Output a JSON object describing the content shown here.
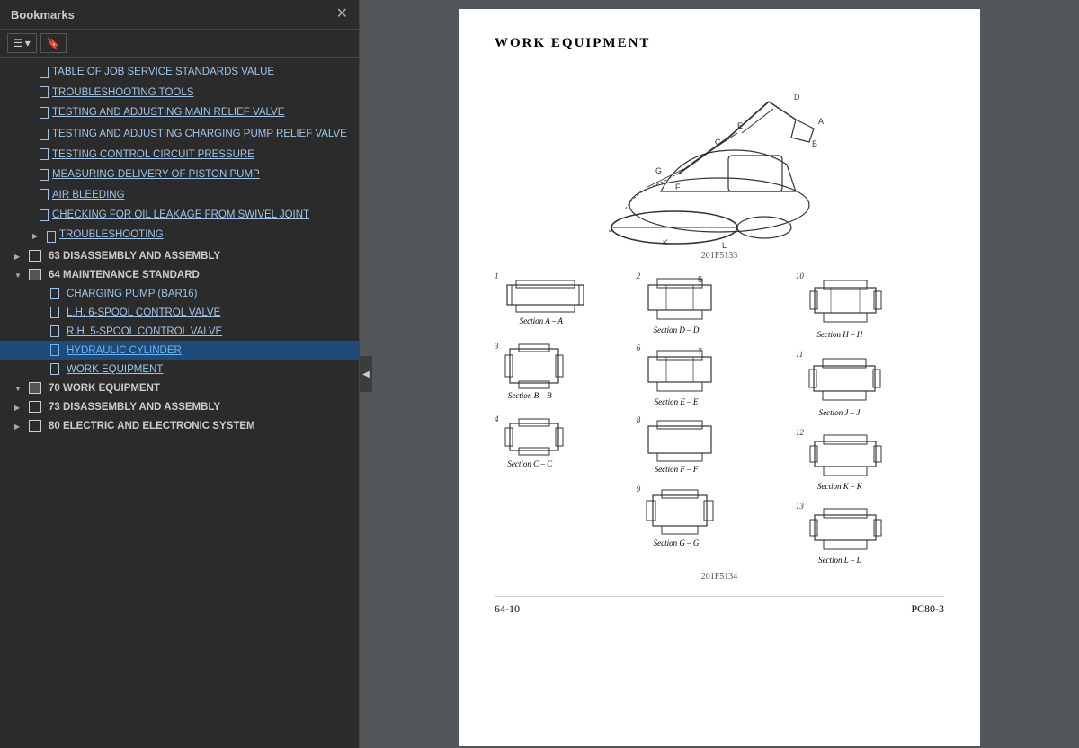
{
  "bookmarks": {
    "title": "Bookmarks",
    "toolbar": {
      "btn1": "☰▾",
      "btn2": "🔖"
    },
    "items": [
      {
        "id": "table-service",
        "label": "TABLE OF JOB SERVICE STANDARDS VALUE",
        "level": 1,
        "indent": "l2",
        "type": "link",
        "expanded": false,
        "active": false
      },
      {
        "id": "troubleshooting-tools",
        "label": "TROUBLESHOOTING TOOLS",
        "level": 1,
        "indent": "l2",
        "type": "link",
        "active": false
      },
      {
        "id": "testing-main-relief",
        "label": "TESTING AND ADJUSTING MAIN RELIEF VALVE",
        "level": 1,
        "indent": "l2",
        "type": "link",
        "active": false
      },
      {
        "id": "testing-charging",
        "label": "TESTING AND ADJUSTING CHARGING PUMP RELIEF VALVE",
        "level": 1,
        "indent": "l2",
        "type": "link",
        "active": false
      },
      {
        "id": "testing-control",
        "label": "TESTING CONTROL CIRCUIT PRESSURE",
        "level": 1,
        "indent": "l2",
        "type": "link",
        "active": false
      },
      {
        "id": "measuring-delivery",
        "label": "MEASURING DELIVERY OF PISTON PUMP",
        "level": 1,
        "indent": "l2",
        "type": "link",
        "active": false
      },
      {
        "id": "air-bleeding",
        "label": "AIR BLEEDING",
        "level": 1,
        "indent": "l2",
        "type": "link",
        "active": false
      },
      {
        "id": "checking-oil",
        "label": "CHECKING FOR OIL LEAKAGE FROM SWIVEL JOINT",
        "level": 1,
        "indent": "l2",
        "type": "link",
        "active": false
      },
      {
        "id": "troubleshooting",
        "label": "TROUBLESHOOTING",
        "level": 1,
        "indent": "l2",
        "type": "link",
        "toggle": "right",
        "active": false
      },
      {
        "id": "disassembly-63",
        "label": "63 DISASSEMBLY AND ASSEMBLY",
        "level": 0,
        "indent": "l1",
        "type": "section",
        "toggle": "right",
        "active": false
      },
      {
        "id": "maintenance-64",
        "label": "64 MAINTENANCE STANDARD",
        "level": 0,
        "indent": "l1",
        "type": "section",
        "toggle": "down",
        "active": false
      },
      {
        "id": "charging-pump",
        "label": "CHARGING PUMP (BAR16)",
        "level": 2,
        "indent": "l3",
        "type": "link",
        "active": false
      },
      {
        "id": "lh-control",
        "label": "L.H. 6-SPOOL CONTROL VALVE",
        "level": 2,
        "indent": "l3",
        "type": "link",
        "active": false
      },
      {
        "id": "rh-control",
        "label": "R.H. 5-SPOOL CONTROL VALVE",
        "level": 2,
        "indent": "l3",
        "type": "link",
        "active": false
      },
      {
        "id": "hydraulic-cylinder",
        "label": "HYDRAULIC CYLINDER",
        "level": 2,
        "indent": "l3",
        "type": "link",
        "active": true
      },
      {
        "id": "work-equipment-bm",
        "label": "WORK EQUIPMENT",
        "level": 2,
        "indent": "l3",
        "type": "link",
        "active": false
      },
      {
        "id": "work-equipment-70",
        "label": "70 WORK EQUIPMENT",
        "level": 0,
        "indent": "l1",
        "type": "section",
        "toggle": "down",
        "active": false
      },
      {
        "id": "disassembly-73",
        "label": "73 DISASSEMBLY AND ASSEMBLY",
        "level": 0,
        "indent": "l1",
        "type": "section",
        "toggle": "right",
        "active": false
      },
      {
        "id": "electric-80",
        "label": "80 ELECTRIC AND ELECTRONIC SYSTEM",
        "level": 0,
        "indent": "l1",
        "type": "section",
        "toggle": "right",
        "active": false
      }
    ]
  },
  "page": {
    "title": "WORK  EQUIPMENT",
    "fig1_number": "201F5133",
    "fig2_number": "201F5134",
    "page_number": "64-10",
    "model": "PC80-3",
    "sections": [
      {
        "id": "A-A",
        "label": "Section A – A",
        "pos": "left-1"
      },
      {
        "id": "D-D",
        "label": "Section D – D",
        "pos": "mid-1"
      },
      {
        "id": "H-H",
        "label": "Section H – H",
        "pos": "right-1"
      },
      {
        "id": "B-B",
        "label": "Section B – B",
        "pos": "left-2"
      },
      {
        "id": "E-E",
        "label": "Section E – E",
        "pos": "mid-2"
      },
      {
        "id": "J-J",
        "label": "Section J – J",
        "pos": "right-2"
      },
      {
        "id": "C-C",
        "label": "Section C – C",
        "pos": "left-3"
      },
      {
        "id": "F-F",
        "label": "Section F – F",
        "pos": "mid-3"
      },
      {
        "id": "K-K",
        "label": "Section K – K",
        "pos": "right-3"
      },
      {
        "id": "G-G",
        "label": "Section G – G",
        "pos": "mid-4"
      },
      {
        "id": "L-L",
        "label": "Section L – L",
        "pos": "right-4"
      }
    ]
  },
  "collapse_arrow": "◀"
}
